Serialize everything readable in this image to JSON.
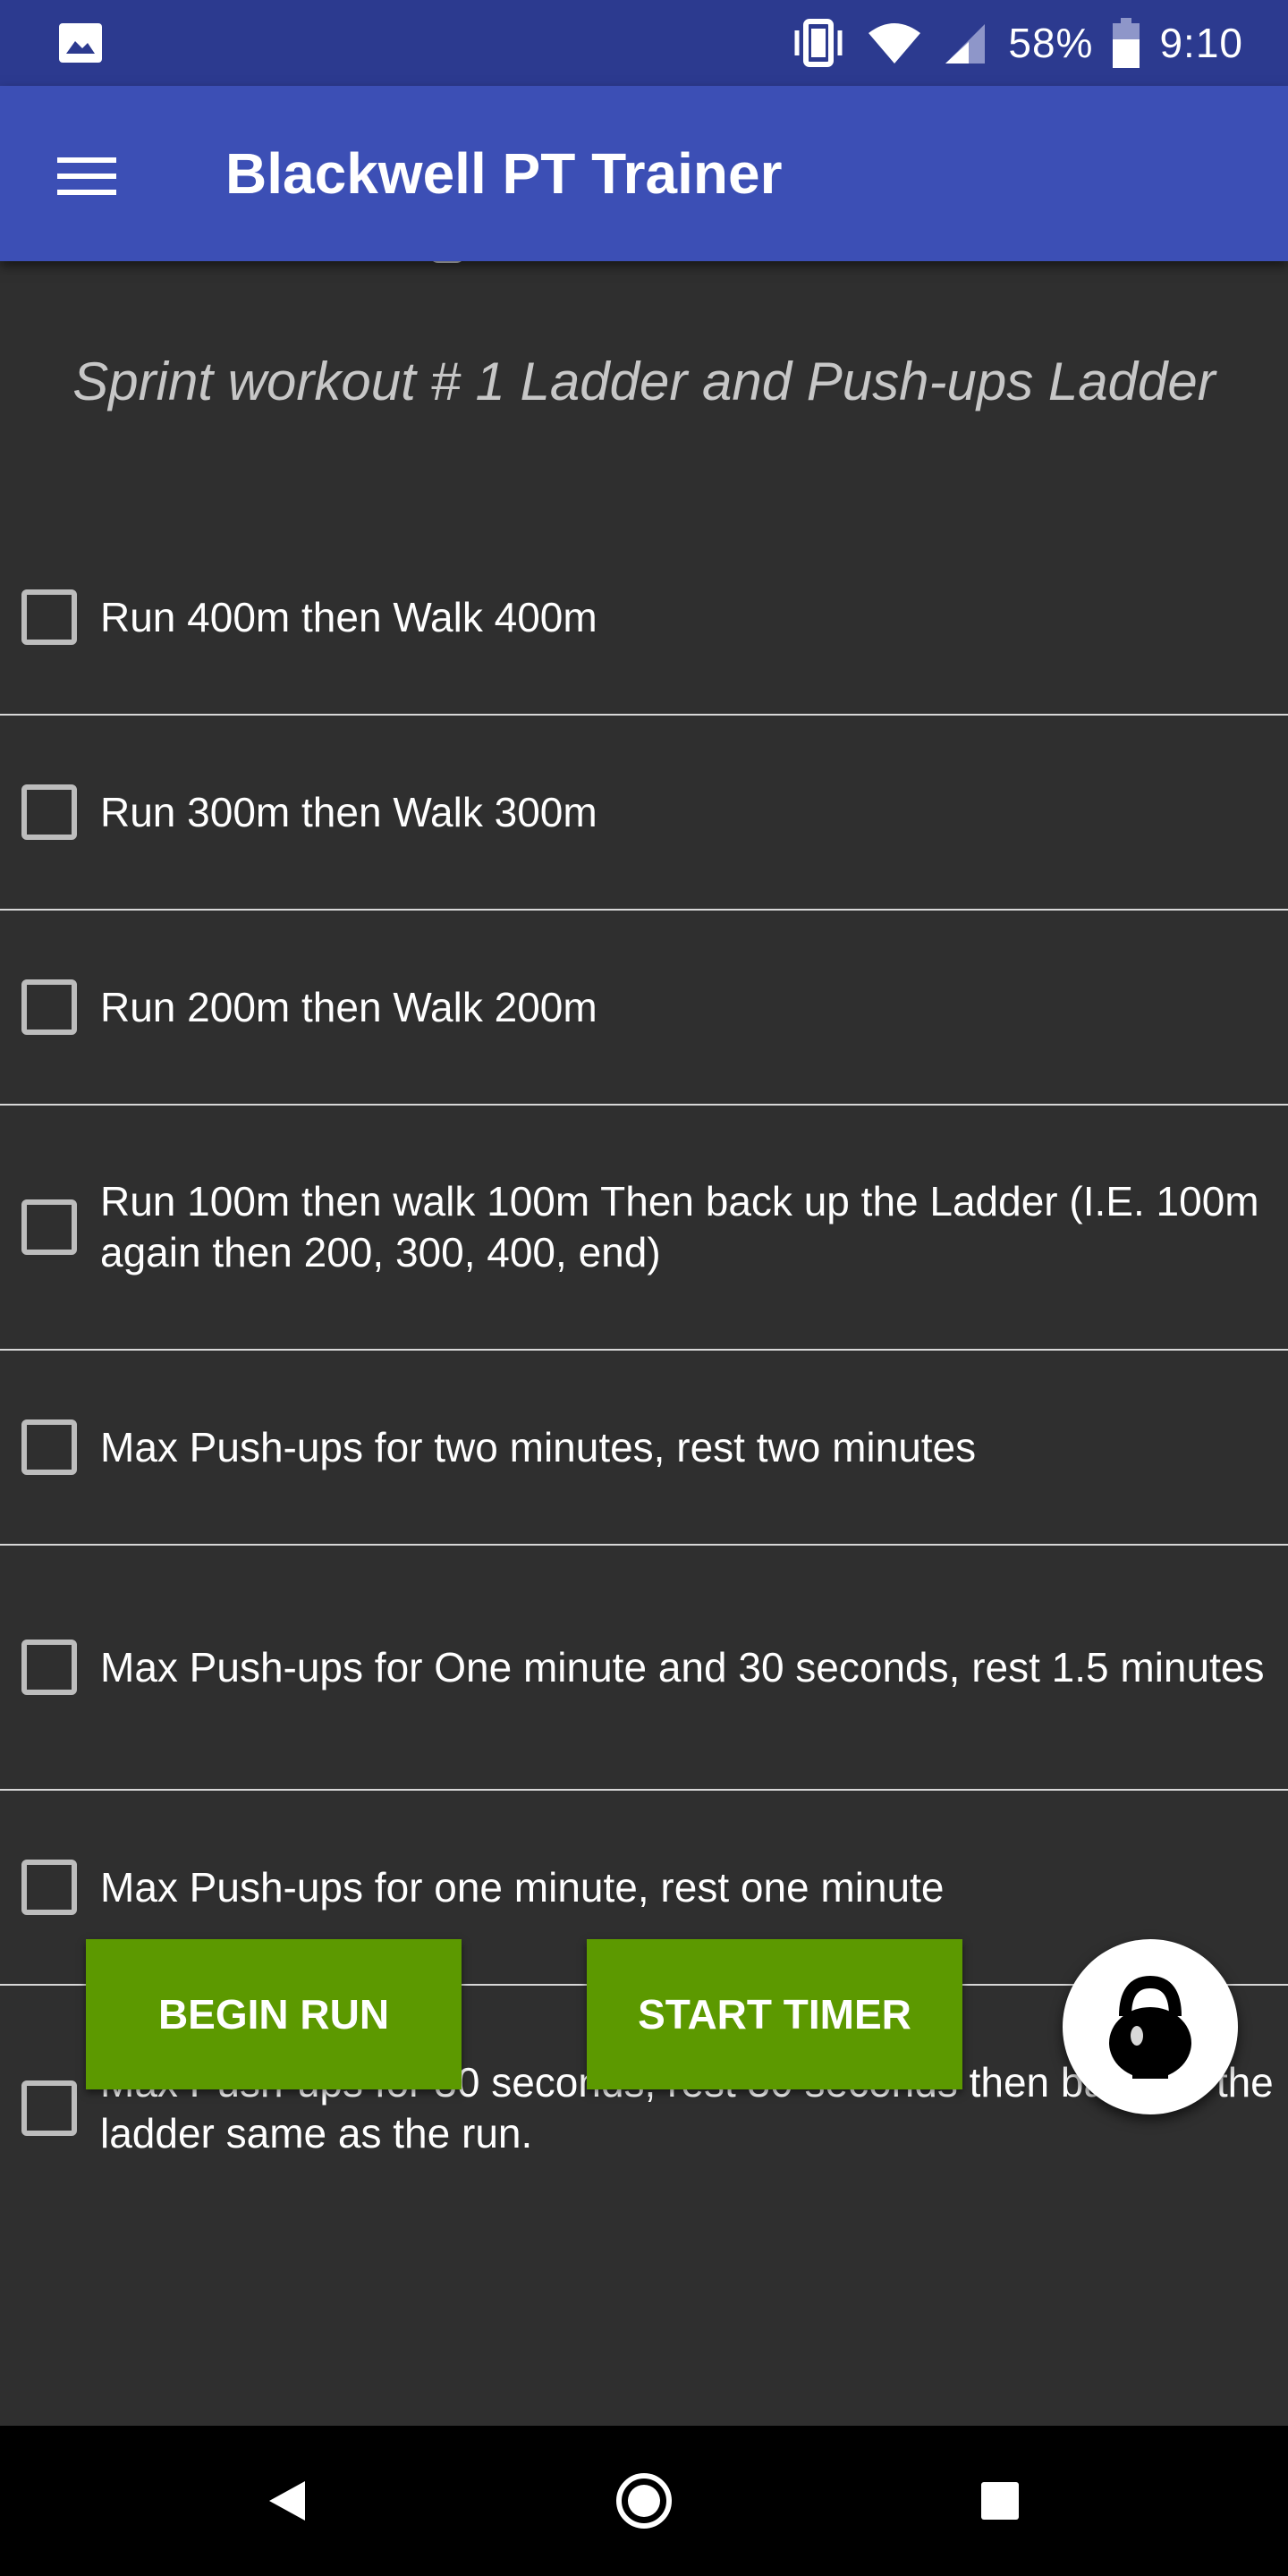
{
  "status_bar": {
    "battery_percent": "58%",
    "time": "9:10",
    "icons": [
      "gallery-icon",
      "vibrate-icon",
      "wifi-icon",
      "cell-signal-icon",
      "battery-icon"
    ]
  },
  "app_bar": {
    "title": "Blackwell PT Trainer",
    "menu_icon": "hamburger-menu-icon"
  },
  "workout": {
    "title": "Sprint workout # 1 Ladder and Push-ups Ladder"
  },
  "tasks": [
    {
      "label": "Run 400m then Walk 400m",
      "checked": false
    },
    {
      "label": "Run 300m then Walk 300m",
      "checked": false
    },
    {
      "label": "Run 200m then Walk 200m",
      "checked": false
    },
    {
      "label": "Run 100m then walk 100m  Then back up the Ladder  (I.E. 100m again then 200, 300, 400, end)",
      "checked": false
    },
    {
      "label": "Max Push-ups for two minutes, rest two minutes",
      "checked": false
    },
    {
      "label": "Max Push-ups for One minute and 30 seconds, rest 1.5 minutes",
      "checked": false
    },
    {
      "label": "Max Push-ups for one minute, rest one minute",
      "checked": false
    },
    {
      "label": "Max Push-ups for 30 seconds, rest 30 seconds then back up the ladder same as the run.",
      "checked": false
    }
  ],
  "buttons": {
    "begin_run": "BEGIN RUN",
    "start_timer": "START TIMER",
    "fab_icon": "kettlebell-icon"
  },
  "colors": {
    "status_bar": "#2c3a8f",
    "app_bar": "#3c4fb5",
    "background": "#2f2f2f",
    "button_green": "#5c9900"
  },
  "nav_bar": {
    "icons": [
      "back-icon",
      "home-icon",
      "recents-icon"
    ]
  }
}
